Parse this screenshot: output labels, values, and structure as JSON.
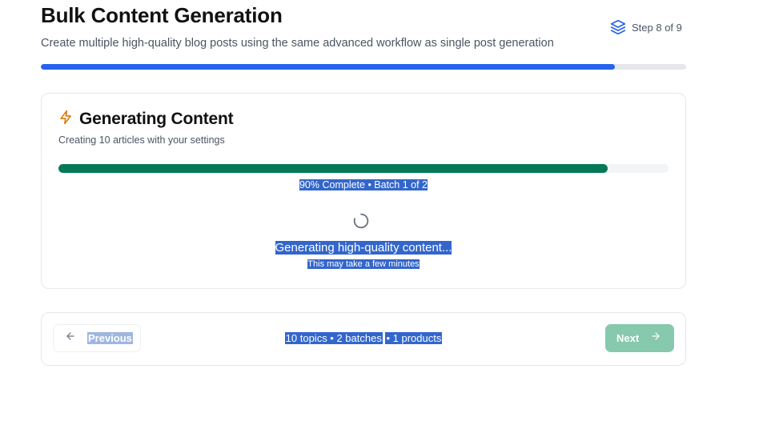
{
  "header": {
    "title": "Bulk Content Generation",
    "subtitle": "Create multiple high-quality blog posts using the same advanced workflow as single post generation",
    "step_label": "Step 8 of 9",
    "step_icon": "layers-icon",
    "progress_fraction": 0.889
  },
  "generation": {
    "icon": "lightning-icon",
    "title": "Generating Content",
    "description": "Creating 10 articles with your settings",
    "progress_percent": 90,
    "status_text": "90% Complete • Batch 1 of 2",
    "spinner_icon": "loading-spinner-icon",
    "message": "Generating high-quality content...",
    "submessage": "This may take a few minutes"
  },
  "navigation": {
    "previous_label": "Previous",
    "next_label": "Next",
    "summary_main": "10 topics • 2 batches",
    "summary_products": "• 1 products"
  },
  "colors": {
    "accent_blue": "#2563eb",
    "progress_green": "#047857",
    "next_button": "#86c9ad",
    "step_icon": "#2563eb",
    "lightning_icon": "#d97706"
  }
}
